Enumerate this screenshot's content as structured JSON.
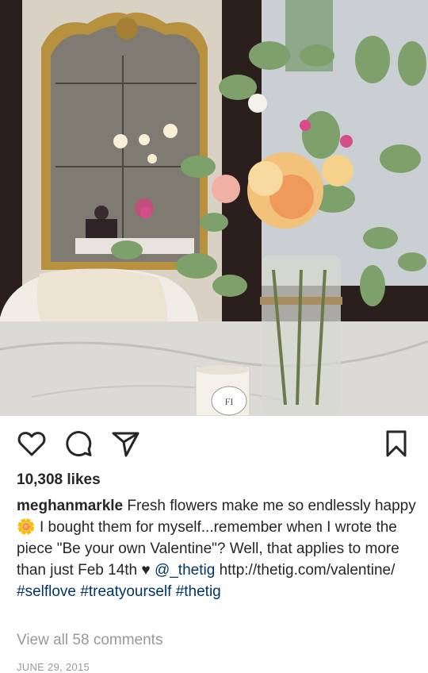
{
  "post": {
    "likes": "10,308 likes",
    "username": "meghanmarkle",
    "caption_part1": "Fresh flowers make me so endlessly happy",
    "caption_emoji": "🌼",
    "caption_part2": "I bought them for myself...remember when I wrote the piece \"Be your own Valentine\"? Well, that applies to more than just Feb 14th",
    "caption_heart": "♥",
    "mention": "@_thetig",
    "url": "http://thetig.com/valentine/",
    "hashtags": [
      "#selflove",
      "#treatyourself",
      "#thetig"
    ],
    "view_comments": "View all 58 comments",
    "date": "JUNE 29, 2015"
  },
  "photo": {
    "candle_label": "FI"
  },
  "icons": {
    "like": "heart-icon",
    "comment": "comment-bubble-icon",
    "share": "paper-plane-icon",
    "save": "bookmark-icon"
  },
  "colors": {
    "text": "#262626",
    "link": "#003569",
    "muted": "#999999"
  }
}
